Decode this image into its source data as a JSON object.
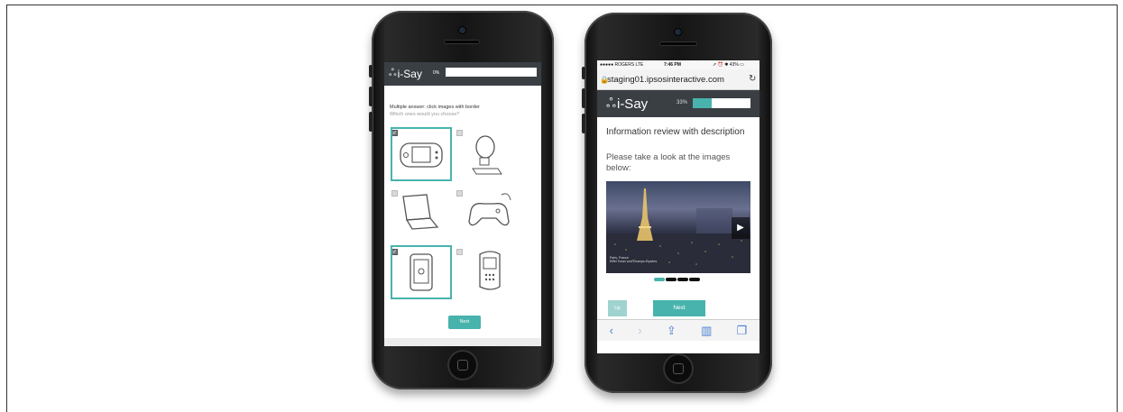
{
  "phone1": {
    "logo": "i-Say",
    "progress_label": "0%",
    "progress": 0.0,
    "question": "Multiple answer: click images with border",
    "subtitle": "Which ones would you choose?",
    "options": [
      {
        "icon": "handheld-console-icon",
        "selected": true
      },
      {
        "icon": "desktop-computer-icon",
        "selected": false
      },
      {
        "icon": "laptop-icon",
        "selected": false
      },
      {
        "icon": "gamepad-icon",
        "selected": false
      },
      {
        "icon": "tablet-icon",
        "selected": true
      },
      {
        "icon": "mobile-phone-icon",
        "selected": false
      }
    ],
    "next_label": "Next",
    "check_glyph": "✓"
  },
  "phone2": {
    "status": {
      "carrier": "●●●●● ROGERS  LTE",
      "time": "7:46 PM",
      "right": "➚ ⏰ ✱ 43% ▭"
    },
    "url": "staging01.ipsosinteractive.com",
    "logo": "i-Say",
    "progress_label": "33%",
    "progress": 0.33,
    "title": "Information review with description",
    "description": "Please take a look at the images below:",
    "image_caption_1": "Paris, France",
    "image_caption_2": "Eiffel Tower and Champs-Elysées",
    "carousel_dots": 4,
    "carousel_active": 0,
    "up_label": "Up",
    "next_label": "Next",
    "toolbar_icons": [
      "back-icon",
      "forward-icon",
      "share-icon",
      "bookmarks-icon",
      "tabs-icon"
    ]
  },
  "colors": {
    "accent": "#48b3ad",
    "header": "#3a3f44"
  }
}
